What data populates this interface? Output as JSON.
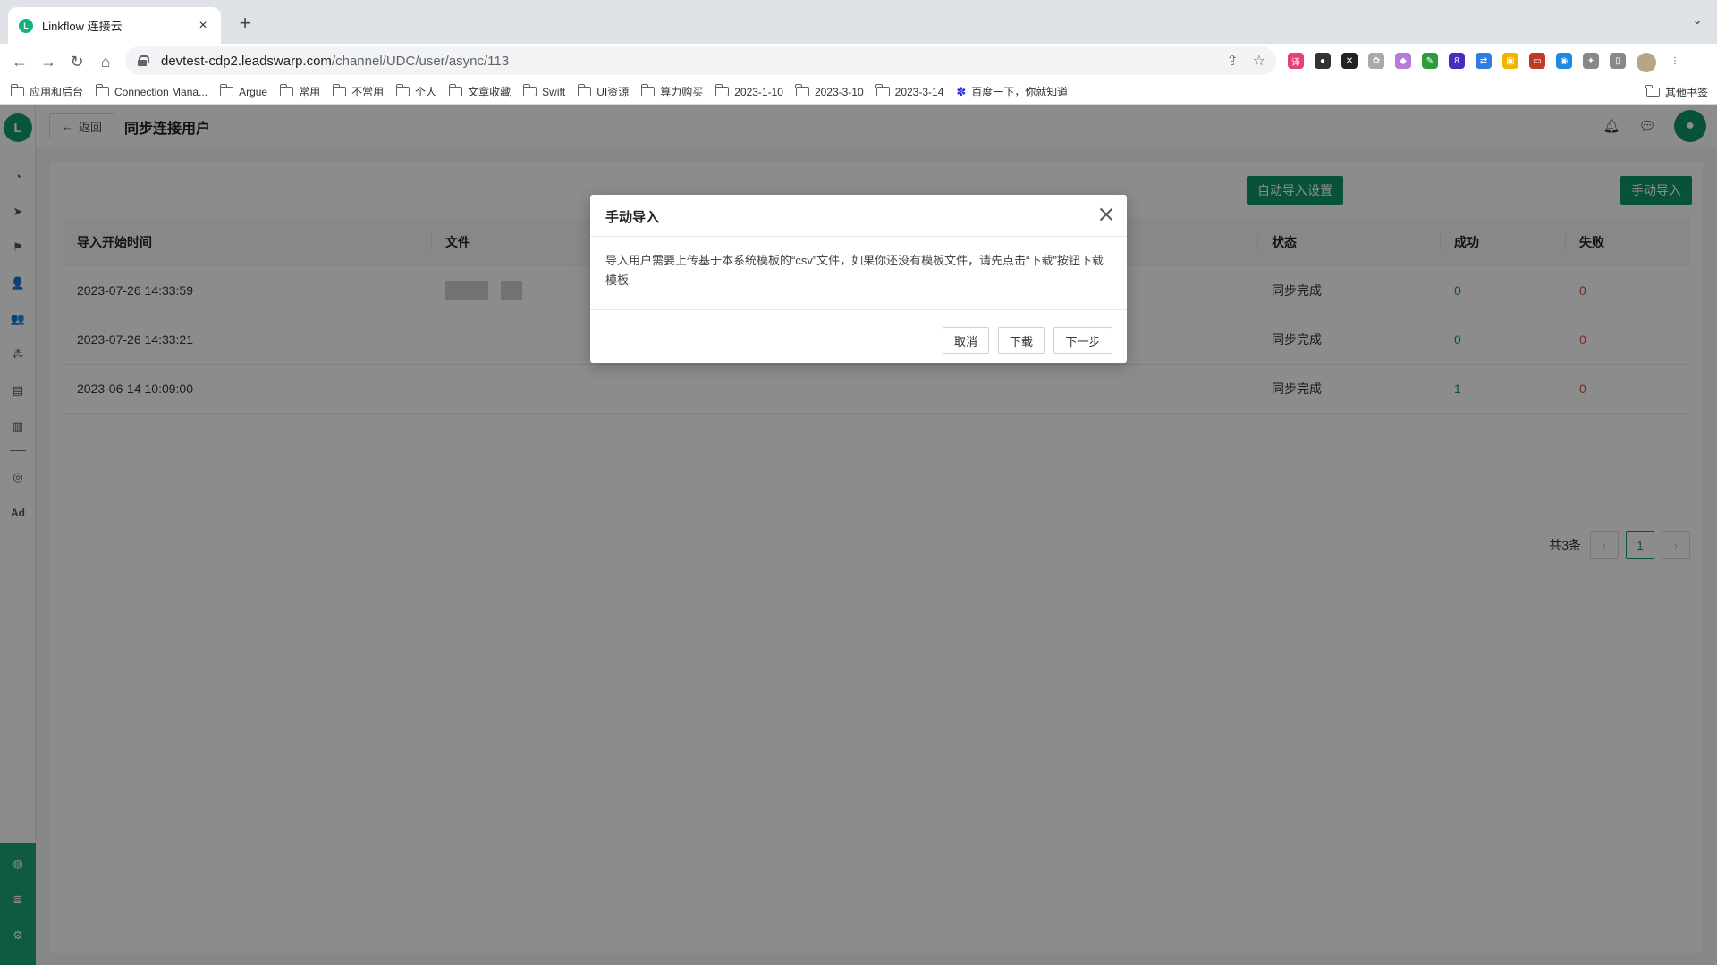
{
  "browser": {
    "tab_title": "Linkflow 连接云",
    "url_host": "devtest-cdp2.leadswarp.com",
    "url_path": "/channel/UDC/user/async/113",
    "bookmarks": [
      "应用和后台",
      "Connection Mana...",
      "Argue",
      "常用",
      "不常用",
      "个人",
      "文章收藏",
      "Swift",
      "UI资源",
      "算力购买",
      "2023-1-10",
      "2023-3-10",
      "2023-3-14",
      "百度一下，你就知道"
    ],
    "other_bookmarks": "其他书签",
    "extension_badge": "8"
  },
  "header": {
    "back_label": "返回",
    "title": "同步连接用户"
  },
  "sidebar": {
    "icons": [
      "dashboard-icon",
      "send-icon",
      "flag-icon",
      "user-icon",
      "users-icon",
      "group-icon",
      "bookmark-icon",
      "bar-chart-icon",
      "wechat-icon",
      "ad-icon",
      "settings-icon"
    ],
    "ad_label": "Ad"
  },
  "actions": {
    "auto_import_label": "自动导入设置",
    "manual_import_label": "手动导入"
  },
  "table": {
    "headers": [
      "导入开始时间",
      "文件",
      "状态",
      "成功",
      "失败"
    ],
    "rows": [
      {
        "time": "2023-07-26 14:33:59",
        "status": "同步完成",
        "success": "0",
        "fail": "0"
      },
      {
        "time": "2023-07-26 14:33:21",
        "status": "同步完成",
        "success": "0",
        "fail": "0"
      },
      {
        "time": "2023-06-14 10:09:00",
        "status": "同步完成",
        "success": "1",
        "fail": "0"
      }
    ]
  },
  "pagination": {
    "total_label": "共3条",
    "current_page": "1"
  },
  "modal": {
    "title": "手动导入",
    "body": "导入用户需要上传基于本系统模板的“csv”文件，如果你还没有模板文件，请先点击“下载”按钮下载模板",
    "cancel_label": "取消",
    "download_label": "下载",
    "next_label": "下一步"
  },
  "colors": {
    "accent": "#11956a",
    "fail": "#e34a3a"
  }
}
